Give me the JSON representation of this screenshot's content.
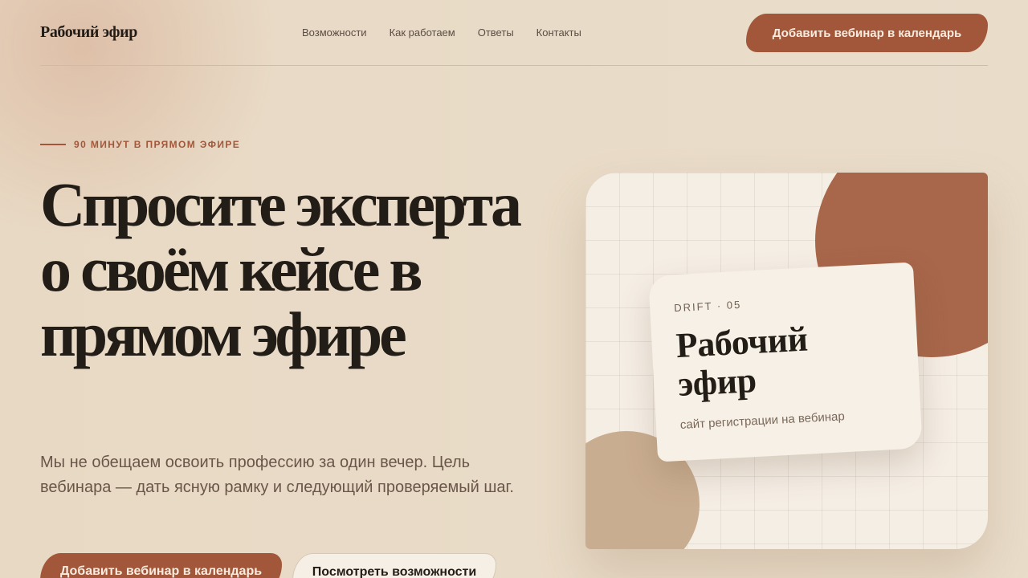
{
  "header": {
    "brand": "Рабочий эфир",
    "nav": [
      "Возможности",
      "Как работаем",
      "Ответы",
      "Контакты"
    ],
    "cta_label": "Добавить вебинар в календарь"
  },
  "hero": {
    "eyebrow": "90 МИНУТ В ПРЯМОМ ЭФИРЕ",
    "headline": "Спросите эксперта о своём кейсе в прямом эфире",
    "lead": "Мы не обещаем освоить профессию за один вечер. Цель вебинара — дать ясную рамку и следующий проверяемый шаг.",
    "primary_button": "Добавить вебинар в календарь",
    "secondary_button": "Посмотреть возможности"
  },
  "visual": {
    "card_tag": "DRIFT · 05",
    "card_title": "Рабочий эфир",
    "card_subtitle": "сайт регистрации на вебинар"
  },
  "colors": {
    "accent": "#a3573a",
    "background": "#e9dcc7",
    "text": "#231d18"
  }
}
